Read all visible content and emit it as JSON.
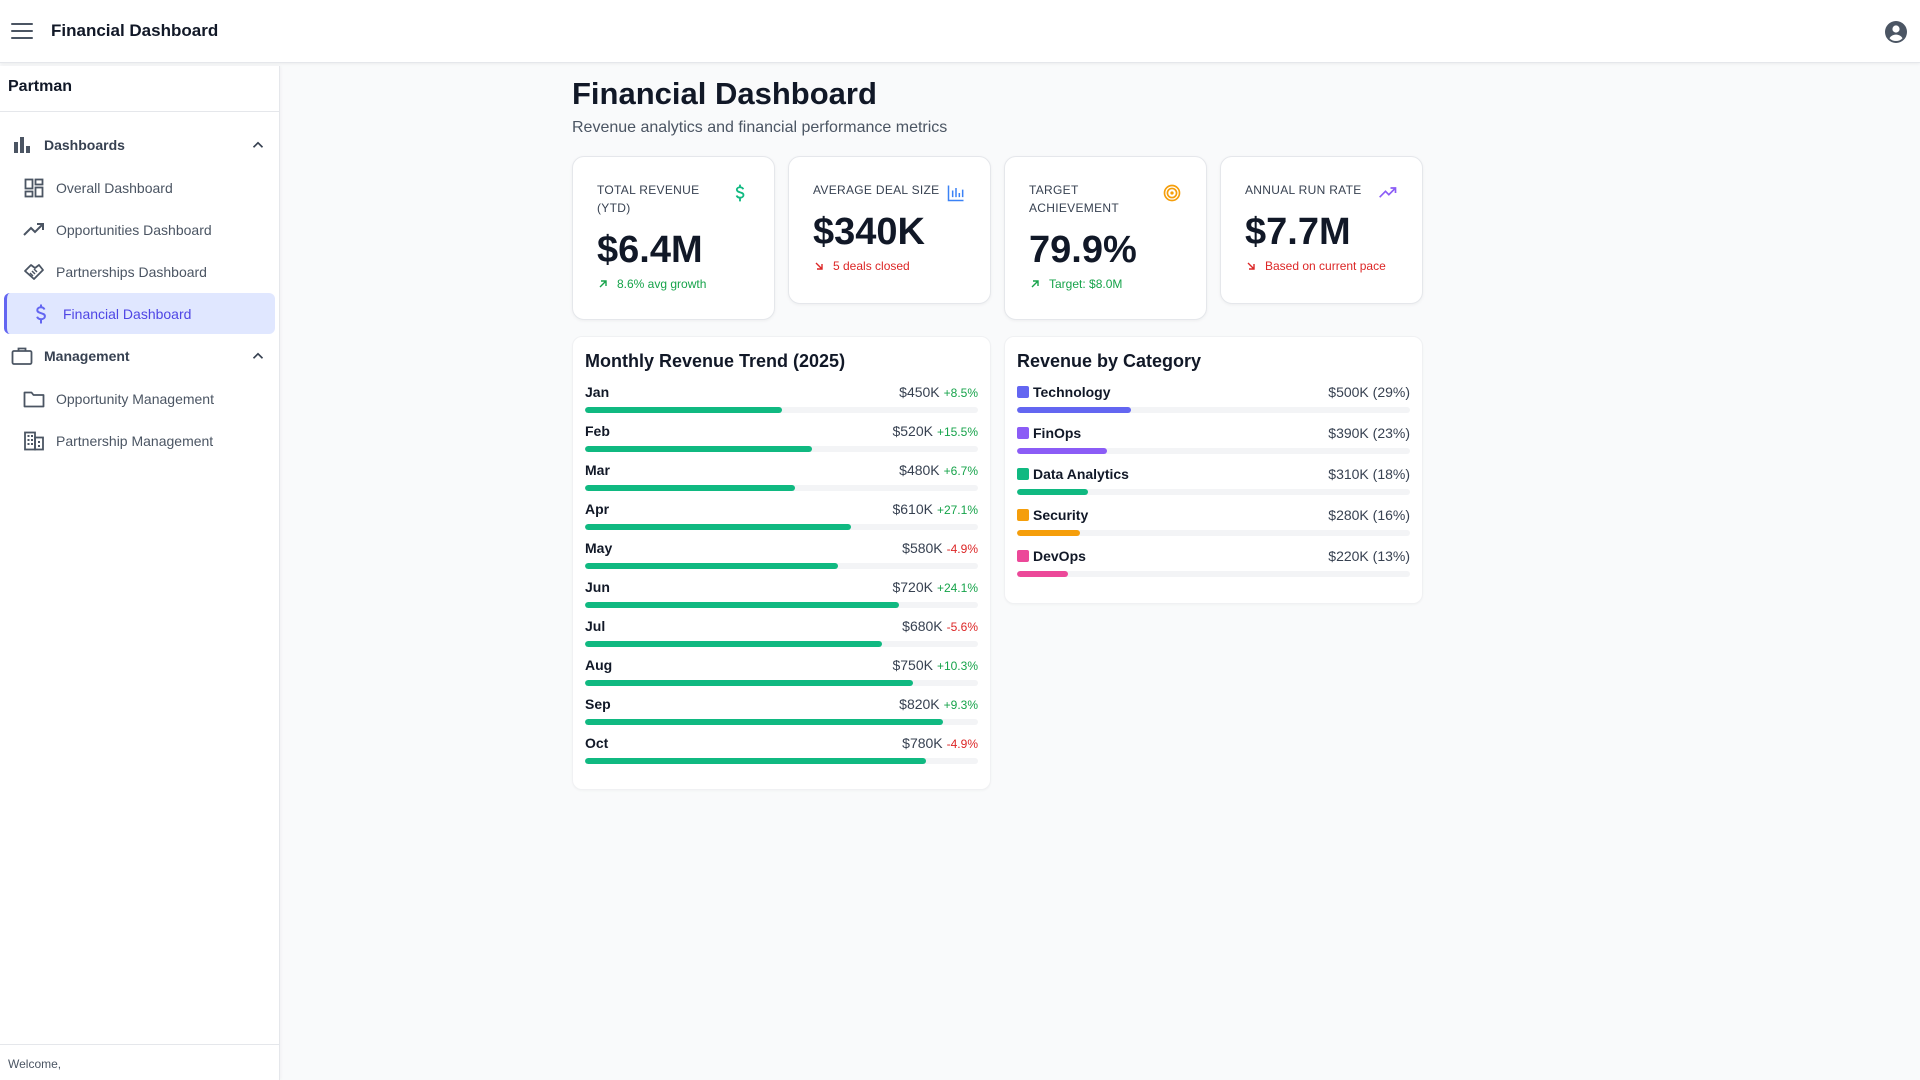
{
  "app": {
    "title": "Financial Dashboard"
  },
  "sidebar": {
    "brand": "Partman",
    "groups": [
      {
        "label": "Dashboards",
        "items": [
          {
            "label": "Overall Dashboard"
          },
          {
            "label": "Opportunities Dashboard"
          },
          {
            "label": "Partnerships Dashboard"
          },
          {
            "label": "Financial Dashboard",
            "active": true
          }
        ]
      },
      {
        "label": "Management",
        "items": [
          {
            "label": "Opportunity Management"
          },
          {
            "label": "Partnership Management"
          }
        ]
      }
    ],
    "footer": "Welcome,"
  },
  "page": {
    "title": "Financial Dashboard",
    "subtitle": "Revenue analytics and financial performance metrics"
  },
  "kpis": [
    {
      "label": "TOTAL REVENUE (YTD)",
      "value": "$6.4M",
      "sub": "8.6% avg growth",
      "trend": "up",
      "icon": "dollar-icon",
      "icon_color": "#10b981"
    },
    {
      "label": "AVERAGE DEAL SIZE",
      "value": "$340K",
      "sub": "5 deals closed",
      "trend": "down",
      "icon": "bar-chart-icon",
      "icon_color": "#3b82f6"
    },
    {
      "label": "TARGET ACHIEVEMENT",
      "value": "79.9%",
      "sub": "Target: $8.0M",
      "trend": "up",
      "icon": "target-icon",
      "icon_color": "#f59e0b"
    },
    {
      "label": "ANNUAL RUN RATE",
      "value": "$7.7M",
      "sub": "Based on current pace",
      "trend": "down",
      "icon": "trending-up-icon",
      "icon_color": "#8b5cf6"
    }
  ],
  "monthly": {
    "title": "Monthly Revenue Trend (2025)",
    "max_value": 900,
    "rows": [
      {
        "month": "Jan",
        "amount": "$450K",
        "change": "+8.5%",
        "trend": "up",
        "value": 450
      },
      {
        "month": "Feb",
        "amount": "$520K",
        "change": "+15.5%",
        "trend": "up",
        "value": 520
      },
      {
        "month": "Mar",
        "amount": "$480K",
        "change": "+6.7%",
        "trend": "up",
        "value": 480
      },
      {
        "month": "Apr",
        "amount": "$610K",
        "change": "+27.1%",
        "trend": "up",
        "value": 610
      },
      {
        "month": "May",
        "amount": "$580K",
        "change": "-4.9%",
        "trend": "down",
        "value": 580
      },
      {
        "month": "Jun",
        "amount": "$720K",
        "change": "+24.1%",
        "trend": "up",
        "value": 720
      },
      {
        "month": "Jul",
        "amount": "$680K",
        "change": "-5.6%",
        "trend": "down",
        "value": 680
      },
      {
        "month": "Aug",
        "amount": "$750K",
        "change": "+10.3%",
        "trend": "up",
        "value": 750
      },
      {
        "month": "Sep",
        "amount": "$820K",
        "change": "+9.3%",
        "trend": "up",
        "value": 820
      },
      {
        "month": "Oct",
        "amount": "$780K",
        "change": "-4.9%",
        "trend": "down",
        "value": 780
      }
    ]
  },
  "category": {
    "title": "Revenue by Category",
    "rows": [
      {
        "name": "Technology",
        "value": "$500K (29%)",
        "percent": 29,
        "color": "#6366f1"
      },
      {
        "name": "FinOps",
        "value": "$390K (23%)",
        "percent": 23,
        "color": "#8b5cf6"
      },
      {
        "name": "Data Analytics",
        "value": "$310K (18%)",
        "percent": 18,
        "color": "#10b981"
      },
      {
        "name": "Security",
        "value": "$280K (16%)",
        "percent": 16,
        "color": "#f59e0b"
      },
      {
        "name": "DevOps",
        "value": "$220K (13%)",
        "percent": 13,
        "color": "#ec4899"
      }
    ]
  }
}
